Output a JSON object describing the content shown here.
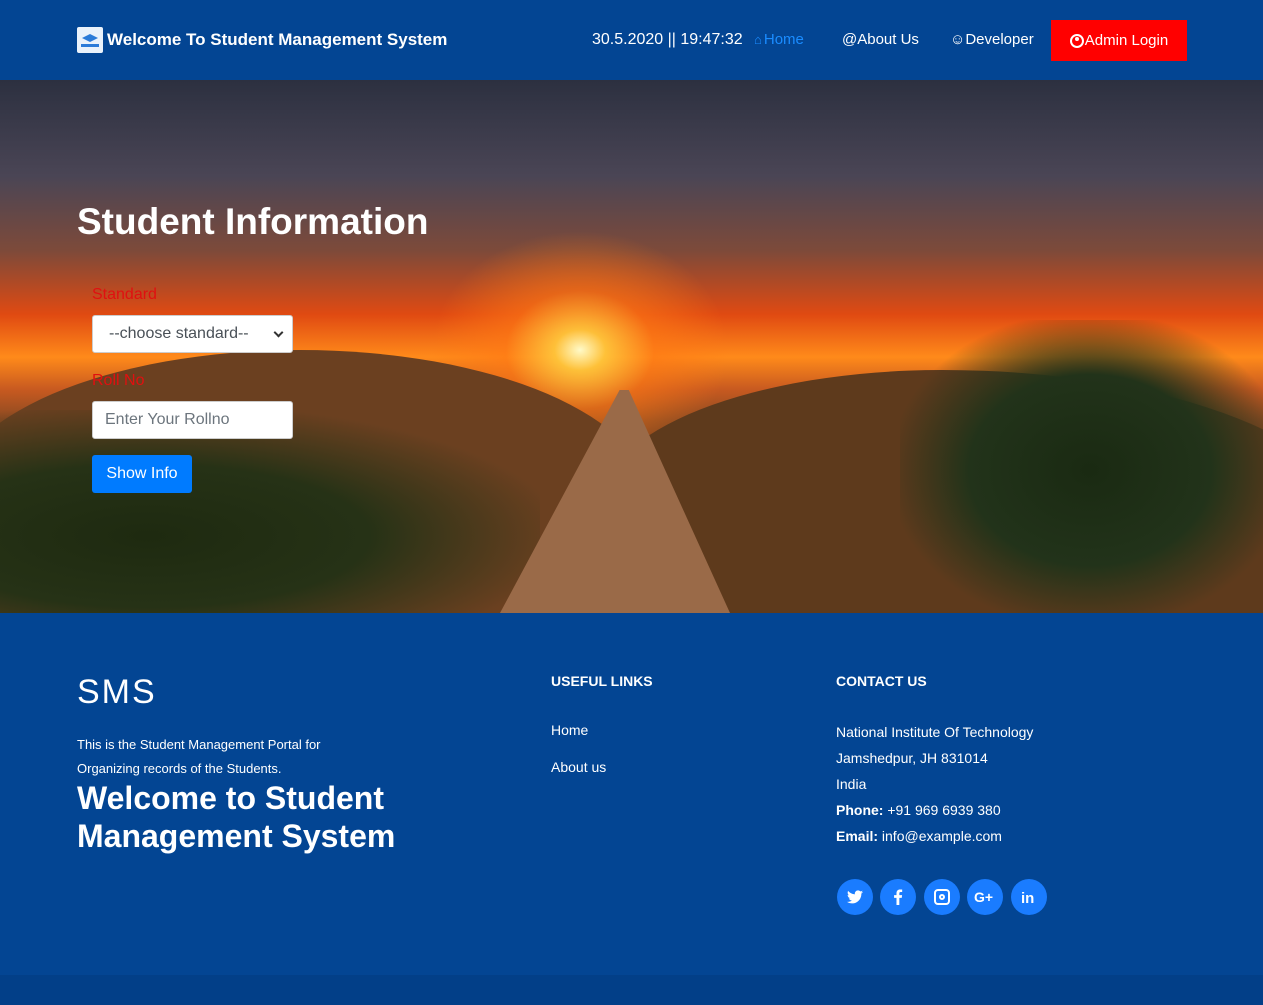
{
  "nav": {
    "brand": "Welcome To Student Management System",
    "clock": "30.5.2020 || 19:47:32",
    "home": "Home",
    "about": "@About Us",
    "developer": "☺Developer",
    "admin_login": "Admin Login",
    "colors": {
      "bg": "#034593",
      "active": "#1a8cff",
      "admin": "#ff0000"
    }
  },
  "hero": {
    "title": "Student Information",
    "standard_label": "Standard",
    "standard_selected": "--choose standard--",
    "roll_label": "Roll No",
    "roll_placeholder": "Enter Your Rollno",
    "show_button": "Show Info"
  },
  "footer": {
    "brand": "SMS",
    "description": "This is the Student Management Portal for Organizing records of the Students.",
    "welcome": "Welcome to Student Management System",
    "useful_links_heading": "USEFUL LINKS",
    "links": [
      "Home",
      "About us"
    ],
    "contact_heading": "CONTACT US",
    "address_line1": "National Institute Of Technology",
    "address_line2": "Jamshedpur, JH 831014",
    "address_line3": "India",
    "phone_label": "Phone:",
    "phone": "+91 969 6939 380",
    "email_label": "Email:",
    "email": "info@example.com",
    "social": [
      "twitter-icon",
      "facebook-icon",
      "instagram-icon",
      "google-plus-icon",
      "linkedin-icon"
    ]
  }
}
